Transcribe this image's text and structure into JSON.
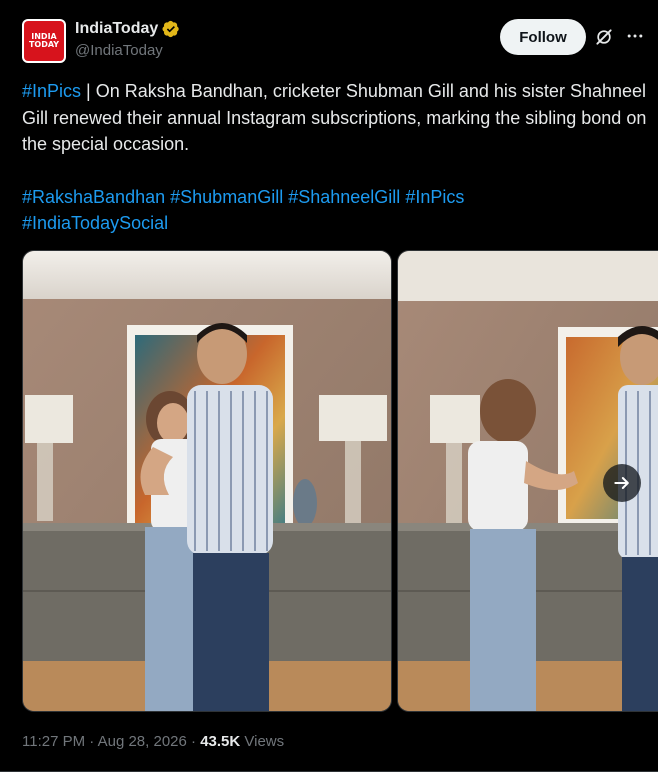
{
  "author": {
    "display_name": "IndiaToday",
    "handle": "@IndiaToday",
    "avatar_text_line1": "INDIA",
    "avatar_text_line2": "TODAY",
    "verified": true
  },
  "header": {
    "follow_label": "Follow",
    "grok_icon": "grok-icon",
    "more_icon": "more-icon"
  },
  "tweet": {
    "lead_hashtag": "#InPics",
    "body": " | On Raksha Bandhan, cricketer Shubman Gill and his sister Shahneel Gill renewed their annual Instagram subscriptions, marking the sibling bond on the special occasion.",
    "hashtags": [
      "#RakshaBandhan",
      "#ShubmanGill",
      "#ShahneelGill",
      "#InPics",
      "#IndiaTodaySocial"
    ]
  },
  "media": {
    "photo_count_visible": 2,
    "next_icon": "arrow-right-icon"
  },
  "meta": {
    "time": "11:27 PM",
    "sep1": " · ",
    "date": "Aug 28, 2026",
    "sep2": " · ",
    "views_count": "43.5K",
    "views_label": " Views"
  },
  "colors": {
    "background": "#000000",
    "text": "#e7e9ea",
    "secondary": "#71767b",
    "link": "#1d9bf0",
    "brand_red": "#d7131c",
    "verified_gold": "#e2b719"
  }
}
